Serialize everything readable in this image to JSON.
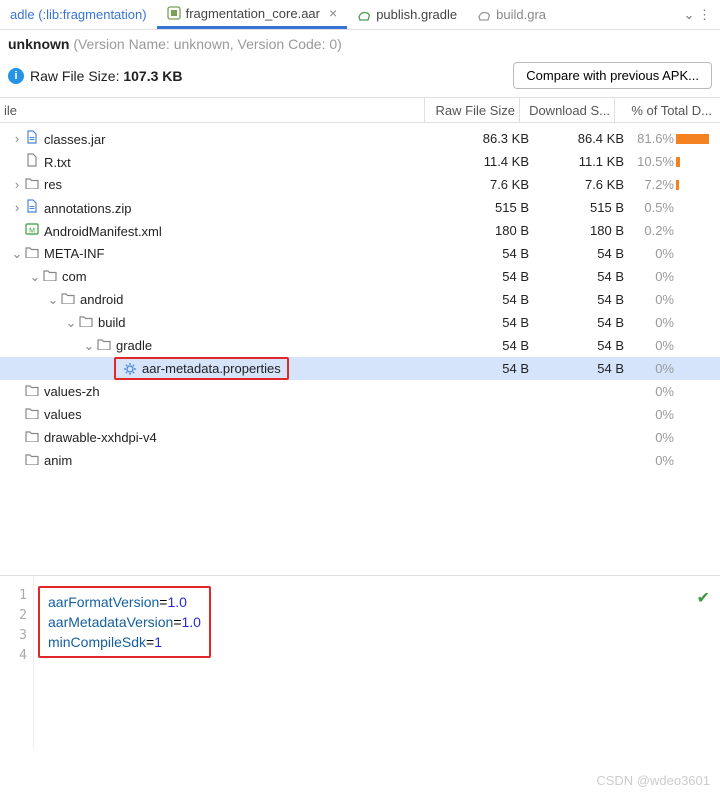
{
  "tabs": {
    "t0": "adle (:lib:fragmentation)",
    "t1": "fragmentation_core.aar",
    "t2": "publish.gradle",
    "t3": "build.gra"
  },
  "header": {
    "line1_prefix": "unknown",
    "line1_muted": " (Version Name: unknown, Version Code: 0)",
    "raw_label": "Raw File Size: ",
    "raw_value": "107.3 KB",
    "compare_btn": "Compare with previous APK..."
  },
  "cols": {
    "file": "ile",
    "raw": "Raw File Size",
    "dl": "Download S...",
    "pct": "% of Total D..."
  },
  "rows": [
    {
      "indent": 0,
      "chev": ">",
      "icon": "file-blue",
      "name": "classes.jar",
      "raw": "86.3 KB",
      "dl": "86.4 KB",
      "pct": "81.6%",
      "bar": 82
    },
    {
      "indent": 0,
      "chev": "",
      "icon": "file",
      "name": "R.txt",
      "raw": "11.4 KB",
      "dl": "11.1 KB",
      "pct": "10.5%",
      "bar": 11
    },
    {
      "indent": 0,
      "chev": ">",
      "icon": "folder",
      "name": "res",
      "raw": "7.6 KB",
      "dl": "7.6 KB",
      "pct": "7.2%",
      "bar": 7
    },
    {
      "indent": 0,
      "chev": ">",
      "icon": "file-blue",
      "name": "annotations.zip",
      "raw": "515 B",
      "dl": "515 B",
      "pct": "0.5%",
      "bar": 0
    },
    {
      "indent": 0,
      "chev": "",
      "icon": "xml",
      "name": "AndroidManifest.xml",
      "raw": "180 B",
      "dl": "180 B",
      "pct": "0.2%",
      "bar": 0
    },
    {
      "indent": 0,
      "chev": "v",
      "icon": "folder",
      "name": "META-INF",
      "raw": "54 B",
      "dl": "54 B",
      "pct": "0%",
      "bar": 0
    },
    {
      "indent": 1,
      "chev": "v",
      "icon": "folder",
      "name": "com",
      "raw": "54 B",
      "dl": "54 B",
      "pct": "0%",
      "bar": 0
    },
    {
      "indent": 2,
      "chev": "v",
      "icon": "folder",
      "name": "android",
      "raw": "54 B",
      "dl": "54 B",
      "pct": "0%",
      "bar": 0
    },
    {
      "indent": 3,
      "chev": "v",
      "icon": "folder",
      "name": "build",
      "raw": "54 B",
      "dl": "54 B",
      "pct": "0%",
      "bar": 0
    },
    {
      "indent": 4,
      "chev": "v",
      "icon": "folder",
      "name": "gradle",
      "raw": "54 B",
      "dl": "54 B",
      "pct": "0%",
      "bar": 0
    },
    {
      "indent": 5,
      "chev": "",
      "icon": "gear",
      "name": "aar-metadata.properties",
      "raw": "54 B",
      "dl": "54 B",
      "pct": "0%",
      "bar": 0,
      "selected": true,
      "boxed": true
    },
    {
      "indent": 0,
      "chev": "",
      "icon": "folder",
      "name": "values-zh",
      "raw": "",
      "dl": "",
      "pct": "0%",
      "bar": 0
    },
    {
      "indent": 0,
      "chev": "",
      "icon": "folder",
      "name": "values",
      "raw": "",
      "dl": "",
      "pct": "0%",
      "bar": 0
    },
    {
      "indent": 0,
      "chev": "",
      "icon": "folder",
      "name": "drawable-xxhdpi-v4",
      "raw": "",
      "dl": "",
      "pct": "0%",
      "bar": 0
    },
    {
      "indent": 0,
      "chev": "",
      "icon": "folder",
      "name": "anim",
      "raw": "",
      "dl": "",
      "pct": "0%",
      "bar": 0
    }
  ],
  "editor": {
    "lines": [
      {
        "n": "1",
        "k": "aarFormatVersion",
        "v": "1.0"
      },
      {
        "n": "2",
        "k": "aarMetadataVersion",
        "v": "1.0"
      },
      {
        "n": "3",
        "k": "minCompileSdk",
        "v": "1"
      },
      {
        "n": "4",
        "k": "",
        "v": ""
      }
    ]
  },
  "footer": "CSDN @wdeo3601"
}
